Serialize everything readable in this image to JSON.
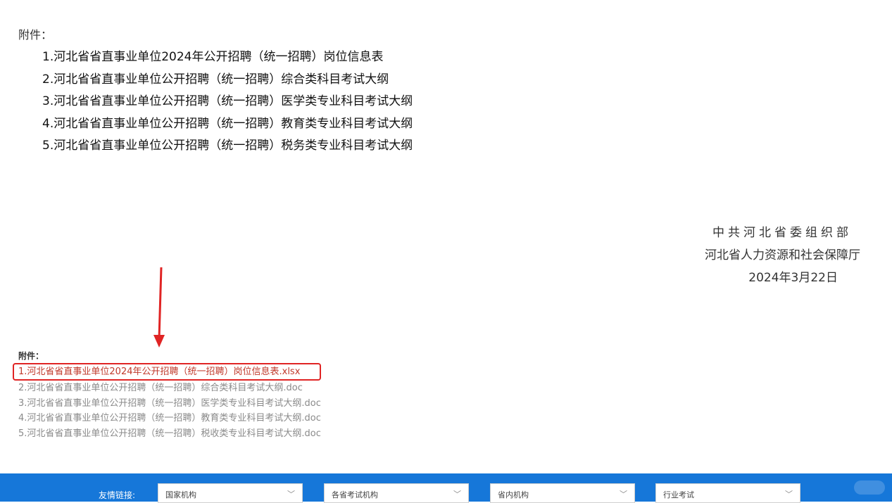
{
  "attachments": {
    "heading": "附件：",
    "items": [
      "1.河北省省直事业单位2024年公开招聘（统一招聘）岗位信息表",
      "2.河北省省直事业单位公开招聘（统一招聘）综合类科目考试大纲",
      "3.河北省省直事业单位公开招聘（统一招聘）医学类专业科目考试大纲",
      "4.河北省省直事业单位公开招聘（统一招聘）教育类专业科目考试大纲",
      "5.河北省省直事业单位公开招聘（统一招聘）税务类专业科目考试大纲"
    ]
  },
  "signature": {
    "org1": "中共河北省委组织部",
    "org2": "河北省人力资源和社会保障厅",
    "date": "2024年3月22日"
  },
  "downloads": {
    "heading": "附件：",
    "files": [
      "1.河北省省直事业单位2024年公开招聘（统一招聘）岗位信息表.xlsx",
      "2.河北省省直事业单位公开招聘（统一招聘）综合类科目考试大纲.doc",
      "3.河北省省直事业单位公开招聘（统一招聘）医学类专业科目考试大纲.doc",
      "4.河北省省直事业单位公开招聘（统一招聘）教育类专业科目考试大纲.doc",
      "5.河北省省直事业单位公开招聘（统一招聘）税收类专业科目考试大纲.doc"
    ]
  },
  "footer": {
    "links_label": "友情链接:",
    "selects": [
      "国家机构",
      "各省考试机构",
      "省内机构",
      "行业考试"
    ]
  },
  "colors": {
    "footer_bg": "#1677d9",
    "highlight": "#e02424"
  }
}
